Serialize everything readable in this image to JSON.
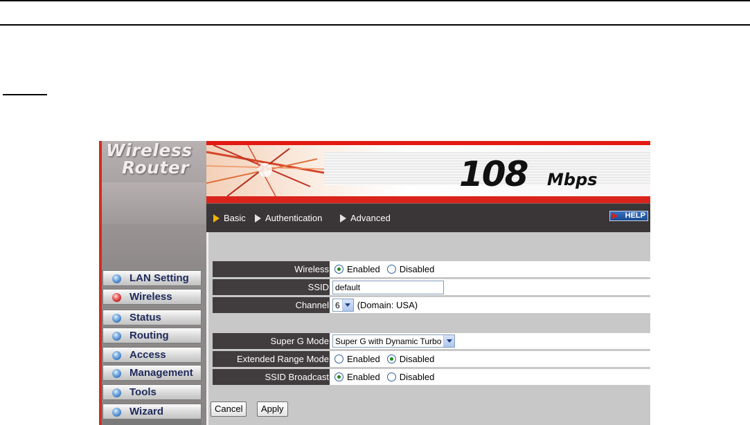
{
  "app": {
    "logo_line1": "Wireless",
    "logo_line2": "Router",
    "speed_number": "108",
    "speed_unit": "Mbps"
  },
  "sidebar": {
    "items": [
      {
        "label": "LAN Setting",
        "active": false
      },
      {
        "label": "Wireless",
        "active": true
      },
      {
        "label": "Status",
        "active": false
      },
      {
        "label": "Routing",
        "active": false
      },
      {
        "label": "Access",
        "active": false
      },
      {
        "label": "Management",
        "active": false
      },
      {
        "label": "Tools",
        "active": false
      },
      {
        "label": "Wizard",
        "active": false
      }
    ]
  },
  "tabs": [
    {
      "label": "Basic"
    },
    {
      "label": "Authentication"
    },
    {
      "label": "Advanced"
    }
  ],
  "help_label": "HELP",
  "form": {
    "wireless": {
      "label": "Wireless",
      "opt1": "Enabled",
      "opt2": "Disabled",
      "selected": "Enabled"
    },
    "ssid": {
      "label": "SSID",
      "value": "default"
    },
    "channel": {
      "label": "Channel",
      "value": "6",
      "note": "(Domain: USA)"
    },
    "super_g": {
      "label": "Super G Mode",
      "value": "Super G with Dynamic Turbo"
    },
    "extended_range": {
      "label": "Extended Range Mode",
      "opt1": "Enabled",
      "opt2": "Disabled",
      "selected": "Disabled"
    },
    "ssid_broadcast": {
      "label": "SSID Broadcast",
      "opt1": "Enabled",
      "opt2": "Disabled",
      "selected": "Enabled"
    }
  },
  "buttons": {
    "cancel": "Cancel",
    "apply": "Apply"
  },
  "colors": {
    "accent_red": "#e21a12",
    "nav_dark": "#3a3536",
    "label_dark": "#413c3d",
    "content_gray": "#c8c8c8",
    "active_dot": "#d42a20",
    "dot_blue": "#2f6fb5"
  }
}
